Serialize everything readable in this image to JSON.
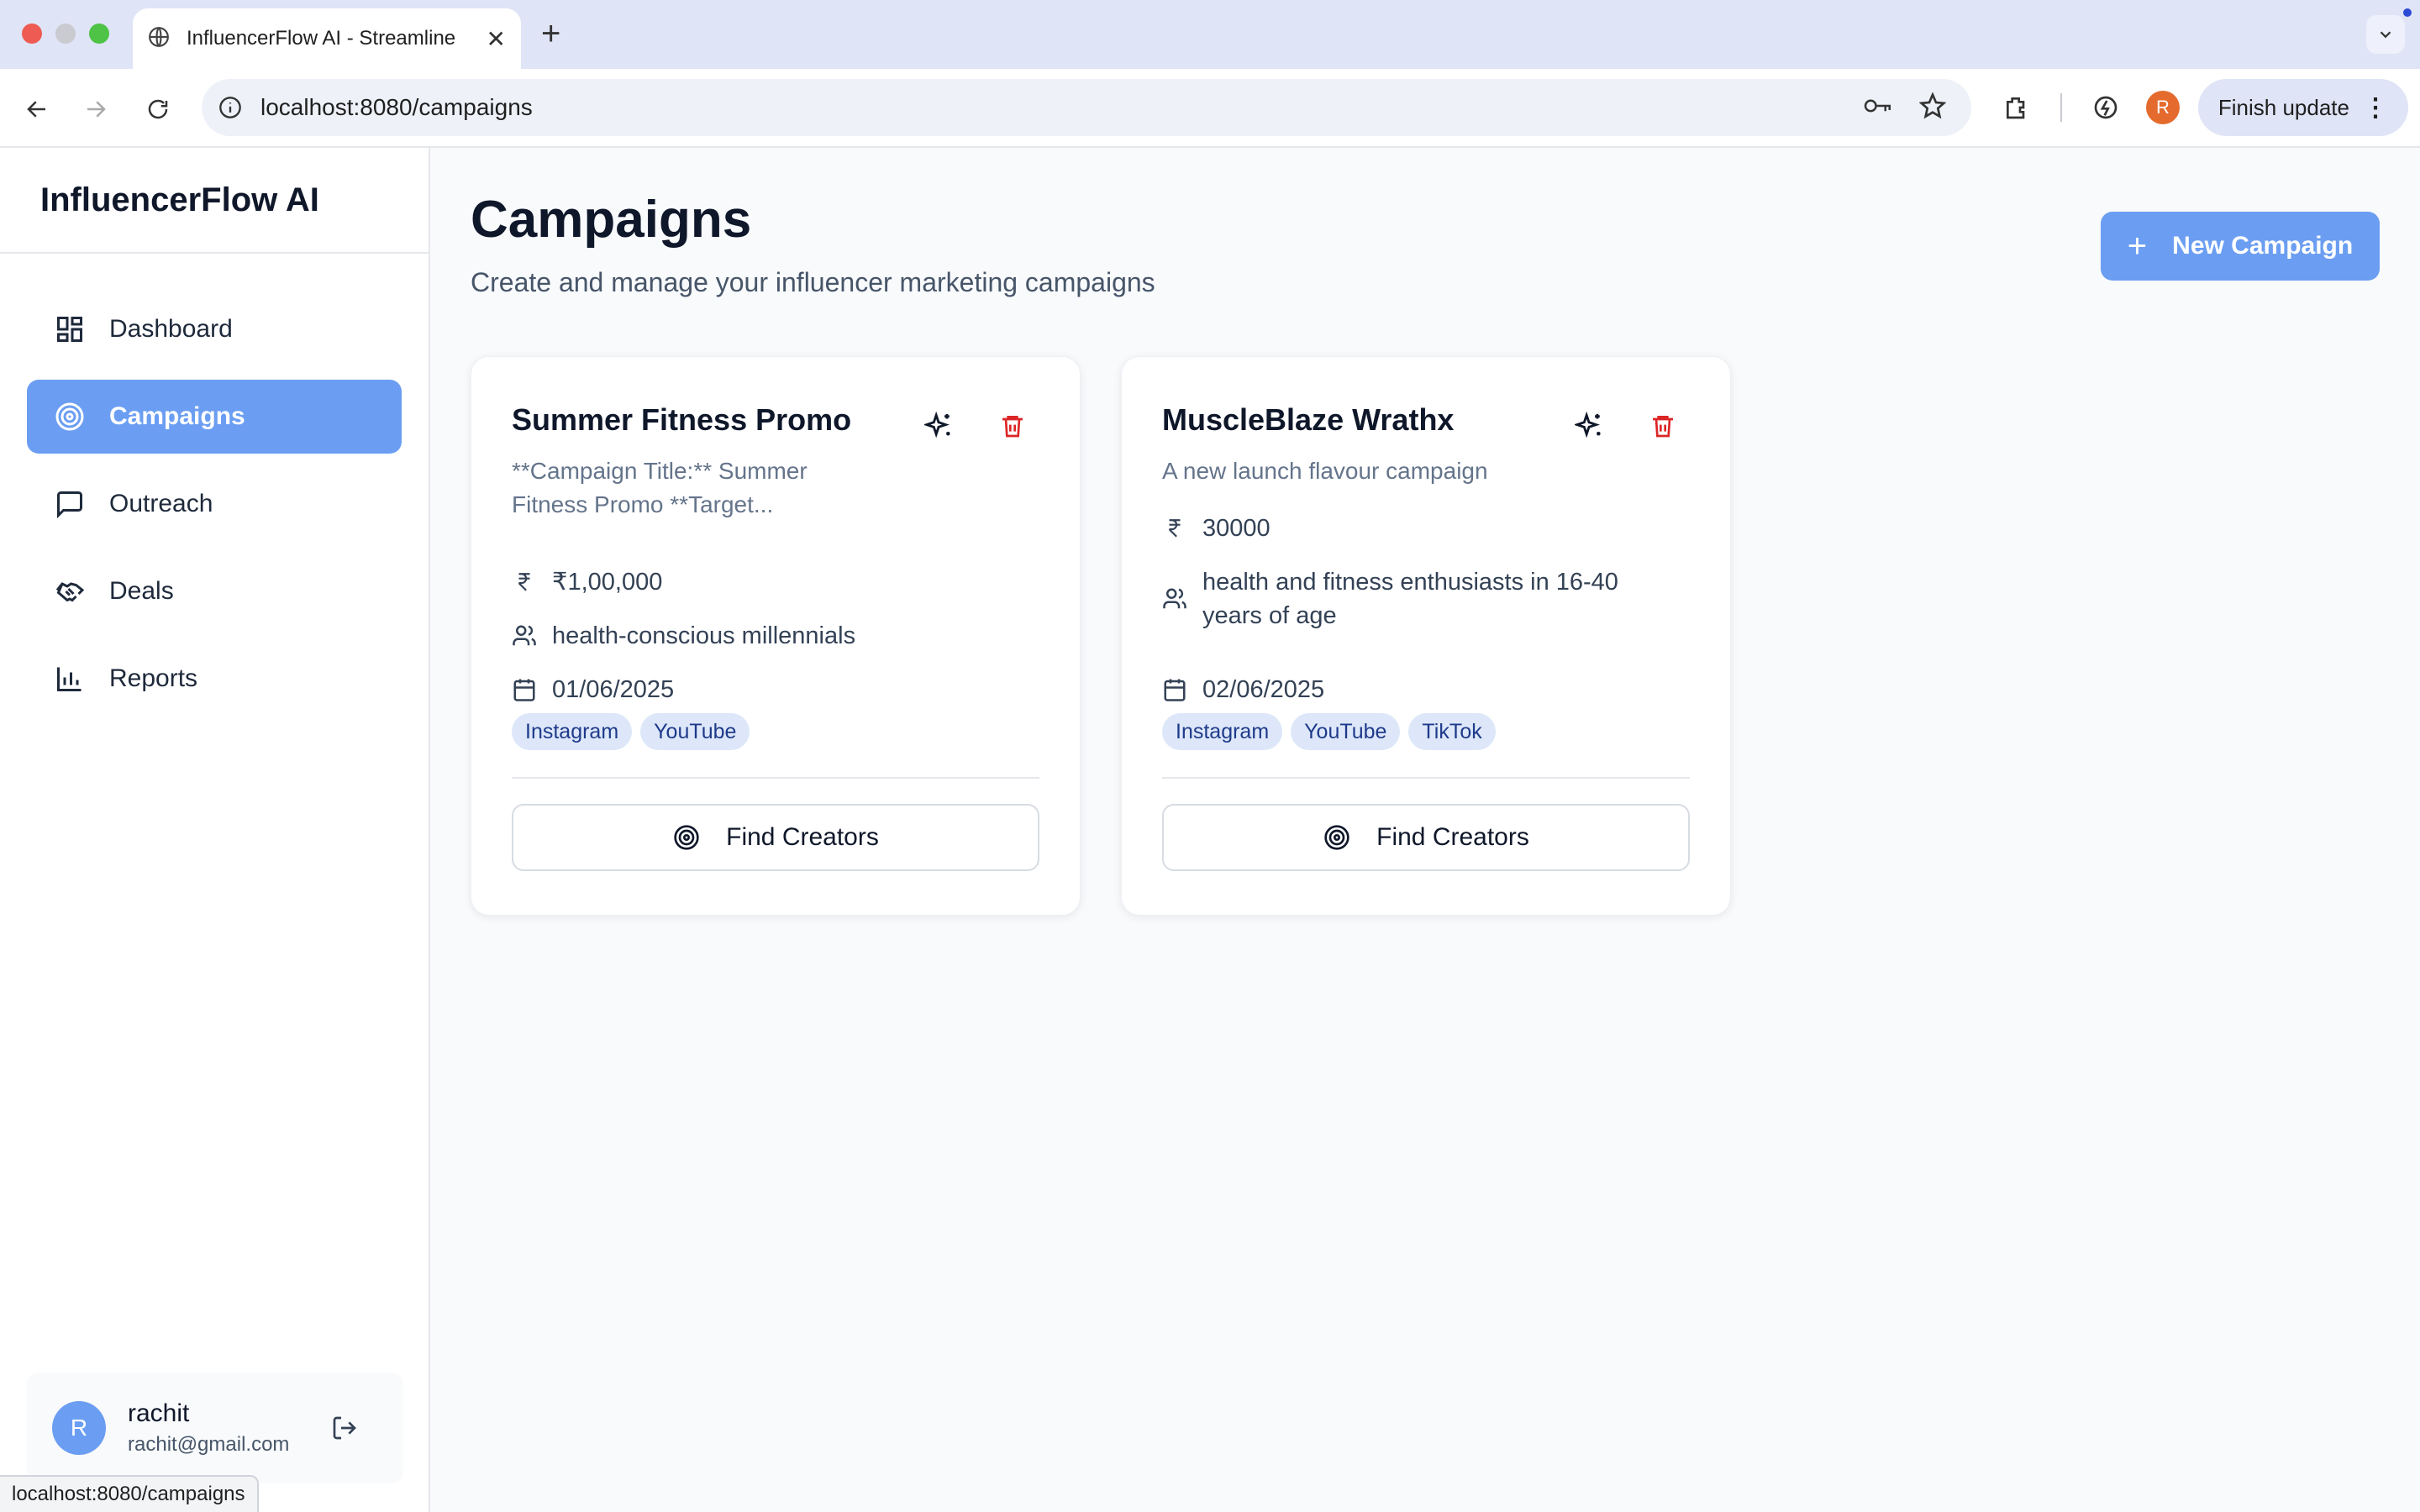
{
  "browser": {
    "tab_title": "InfluencerFlow AI - Streamline",
    "url": "localhost:8080/campaigns",
    "profile_initial": "R",
    "finish_update_label": "Finish update",
    "status_url": "localhost:8080/campaigns"
  },
  "sidebar": {
    "brand": "InfluencerFlow AI",
    "items": [
      {
        "label": "Dashboard",
        "icon": "dashboard-icon"
      },
      {
        "label": "Campaigns",
        "icon": "target-icon",
        "active": true
      },
      {
        "label": "Outreach",
        "icon": "message-icon"
      },
      {
        "label": "Deals",
        "icon": "handshake-icon"
      },
      {
        "label": "Reports",
        "icon": "bar-chart-icon"
      }
    ],
    "user": {
      "initial": "R",
      "name": "rachit",
      "email": "rachit@gmail.com"
    }
  },
  "main": {
    "title": "Campaigns",
    "subtitle": "Create and manage your influencer marketing campaigns",
    "new_button": "New Campaign",
    "cards": [
      {
        "title": "Summer Fitness Promo",
        "description": "**Campaign Title:** Summer Fitness Promo **Target...",
        "budget": "₹1,00,000",
        "audience": "health-conscious millennials",
        "date": "01/06/2025",
        "platforms": [
          "Instagram",
          "YouTube"
        ],
        "find_label": "Find Creators"
      },
      {
        "title": "MuscleBlaze Wrathx",
        "description": "A new launch flavour campaign",
        "budget": "30000",
        "audience": "health and fitness enthusiasts in 16-40 years of age",
        "date": "02/06/2025",
        "platforms": [
          "Instagram",
          "YouTube",
          "TikTok"
        ],
        "find_label": "Find Creators"
      }
    ]
  },
  "colors": {
    "accent": "#6b9ef2",
    "danger": "#dc2626",
    "tag_bg": "#dde7f9"
  }
}
